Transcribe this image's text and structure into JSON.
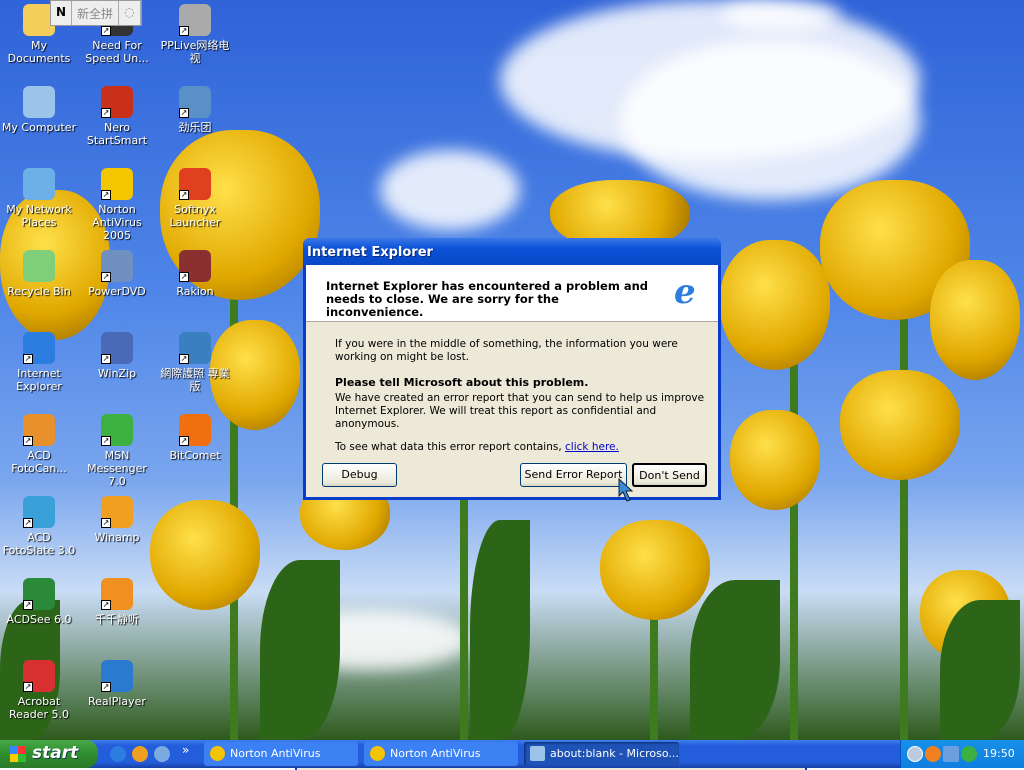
{
  "ime_bar": {
    "mode": "新全拼"
  },
  "desktop_icons": [
    {
      "label": "My Documents",
      "color": "#f3cf5a"
    },
    {
      "label": "My Computer",
      "color": "#9cc4ea"
    },
    {
      "label": "My Network Places",
      "color": "#6cb0e8"
    },
    {
      "label": "Recycle Bin",
      "color": "#7fcf7a"
    },
    {
      "label": "Internet Explorer",
      "color": "#2b7de0"
    },
    {
      "label": "ACD FotoCan...",
      "color": "#e8902a"
    },
    {
      "label": "ACD FotoSlate 3.0",
      "color": "#3aa0d8"
    },
    {
      "label": "ACDSee 6.0",
      "color": "#2a8a3a"
    },
    {
      "label": "Acrobat Reader 5.0",
      "color": "#d83030"
    },
    {
      "label": "Need For Speed Un...",
      "color": "#333333"
    },
    {
      "label": "Nero StartSmart",
      "color": "#c8301a"
    },
    {
      "label": "Norton AntiVirus 2005",
      "color": "#f2c600"
    },
    {
      "label": "PowerDVD",
      "color": "#7090c0"
    },
    {
      "label": "WinZip",
      "color": "#4a6ab8"
    },
    {
      "label": "MSN Messenger 7.0",
      "color": "#3cb040"
    },
    {
      "label": "Winamp",
      "color": "#f0a020"
    },
    {
      "label": "千千静听",
      "color": "#f09020"
    },
    {
      "label": "RealPlayer",
      "color": "#2a7ad0"
    },
    {
      "label": "PPLive网络电视",
      "color": "#aaaaaa"
    },
    {
      "label": "劲乐团",
      "color": "#5a90c8"
    },
    {
      "label": "Softnyx Launcher",
      "color": "#e04020"
    },
    {
      "label": "Rakion",
      "color": "#8a3030"
    },
    {
      "label": "網際護照 專業版",
      "color": "#3a80c0"
    },
    {
      "label": "BitComet",
      "color": "#f07010"
    }
  ],
  "dialog": {
    "title": "Internet Explorer",
    "headline": "Internet Explorer has encountered a problem and needs to close.  We are sorry for the inconvenience.",
    "info": "If you were in the middle of something, the information you were working on might be lost.",
    "tell_heading": "Please tell Microsoft about this problem.",
    "tell_body": "We have created an error report that you can send to help us improve Internet Explorer.  We will treat this report as confidential and anonymous.",
    "see_data": "To see what data this error report contains,",
    "click_here": "click here.",
    "debug": "Debug",
    "send": "Send Error Report",
    "dont_send": "Don't Send"
  },
  "taskbar": {
    "start": "start",
    "overflow": "»",
    "tasks": [
      {
        "label": "Norton AntiVirus",
        "active": false
      },
      {
        "label": "Norton AntiVirus",
        "active": false
      },
      {
        "label": "about:blank - Microso...",
        "active": true
      }
    ],
    "clock": "19:50"
  }
}
